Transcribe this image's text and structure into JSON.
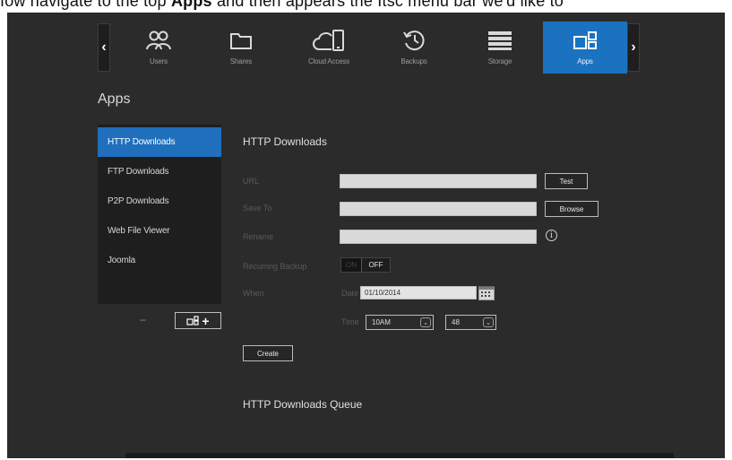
{
  "caption_strip": {
    "pre": "Iow navigate to the top",
    "bold": "Apps",
    "post": "and then appears the Itsc menu bar we'd like to"
  },
  "nav": {
    "items": [
      {
        "label": "Users",
        "icon": "users-icon"
      },
      {
        "label": "Shares",
        "icon": "folder-icon"
      },
      {
        "label": "Cloud Access",
        "icon": "cloud-device-icon"
      },
      {
        "label": "Backups",
        "icon": "history-icon"
      },
      {
        "label": "Storage",
        "icon": "storage-icon"
      },
      {
        "label": "Apps",
        "icon": "apps-icon"
      }
    ],
    "active": "Apps",
    "prev": "‹",
    "next": "›"
  },
  "page": {
    "title": "Apps"
  },
  "sidebar": {
    "items": [
      {
        "label": "HTTP Downloads"
      },
      {
        "label": "FTP Downloads"
      },
      {
        "label": "P2P Downloads"
      },
      {
        "label": "Web File Viewer"
      },
      {
        "label": "Joomla"
      }
    ],
    "active": "HTTP Downloads",
    "remove_label": "−",
    "add_label": "+"
  },
  "form": {
    "section_title": "HTTP Downloads",
    "url_label": "URL",
    "save_to_label": "Save To",
    "rename_label": "Rename",
    "recurring_label": "Recurring Backup",
    "when_label": "When",
    "date_label": "Date",
    "time_label": "Time",
    "url_value": "",
    "save_to_value": "",
    "rename_value": "",
    "test_button": "Test",
    "browse_button": "Browse",
    "info_glyph": "i",
    "toggle_on": "ON",
    "toggle_off": "OFF",
    "date_value": "01/10/2014",
    "hour_value": "10AM",
    "minute_value": "48",
    "create_button": "Create",
    "queue_title": "HTTP Downloads Queue"
  },
  "colors": {
    "accent": "#1a72c0",
    "background": "#2b2b2b",
    "sidebar": "#1e1e1e"
  }
}
